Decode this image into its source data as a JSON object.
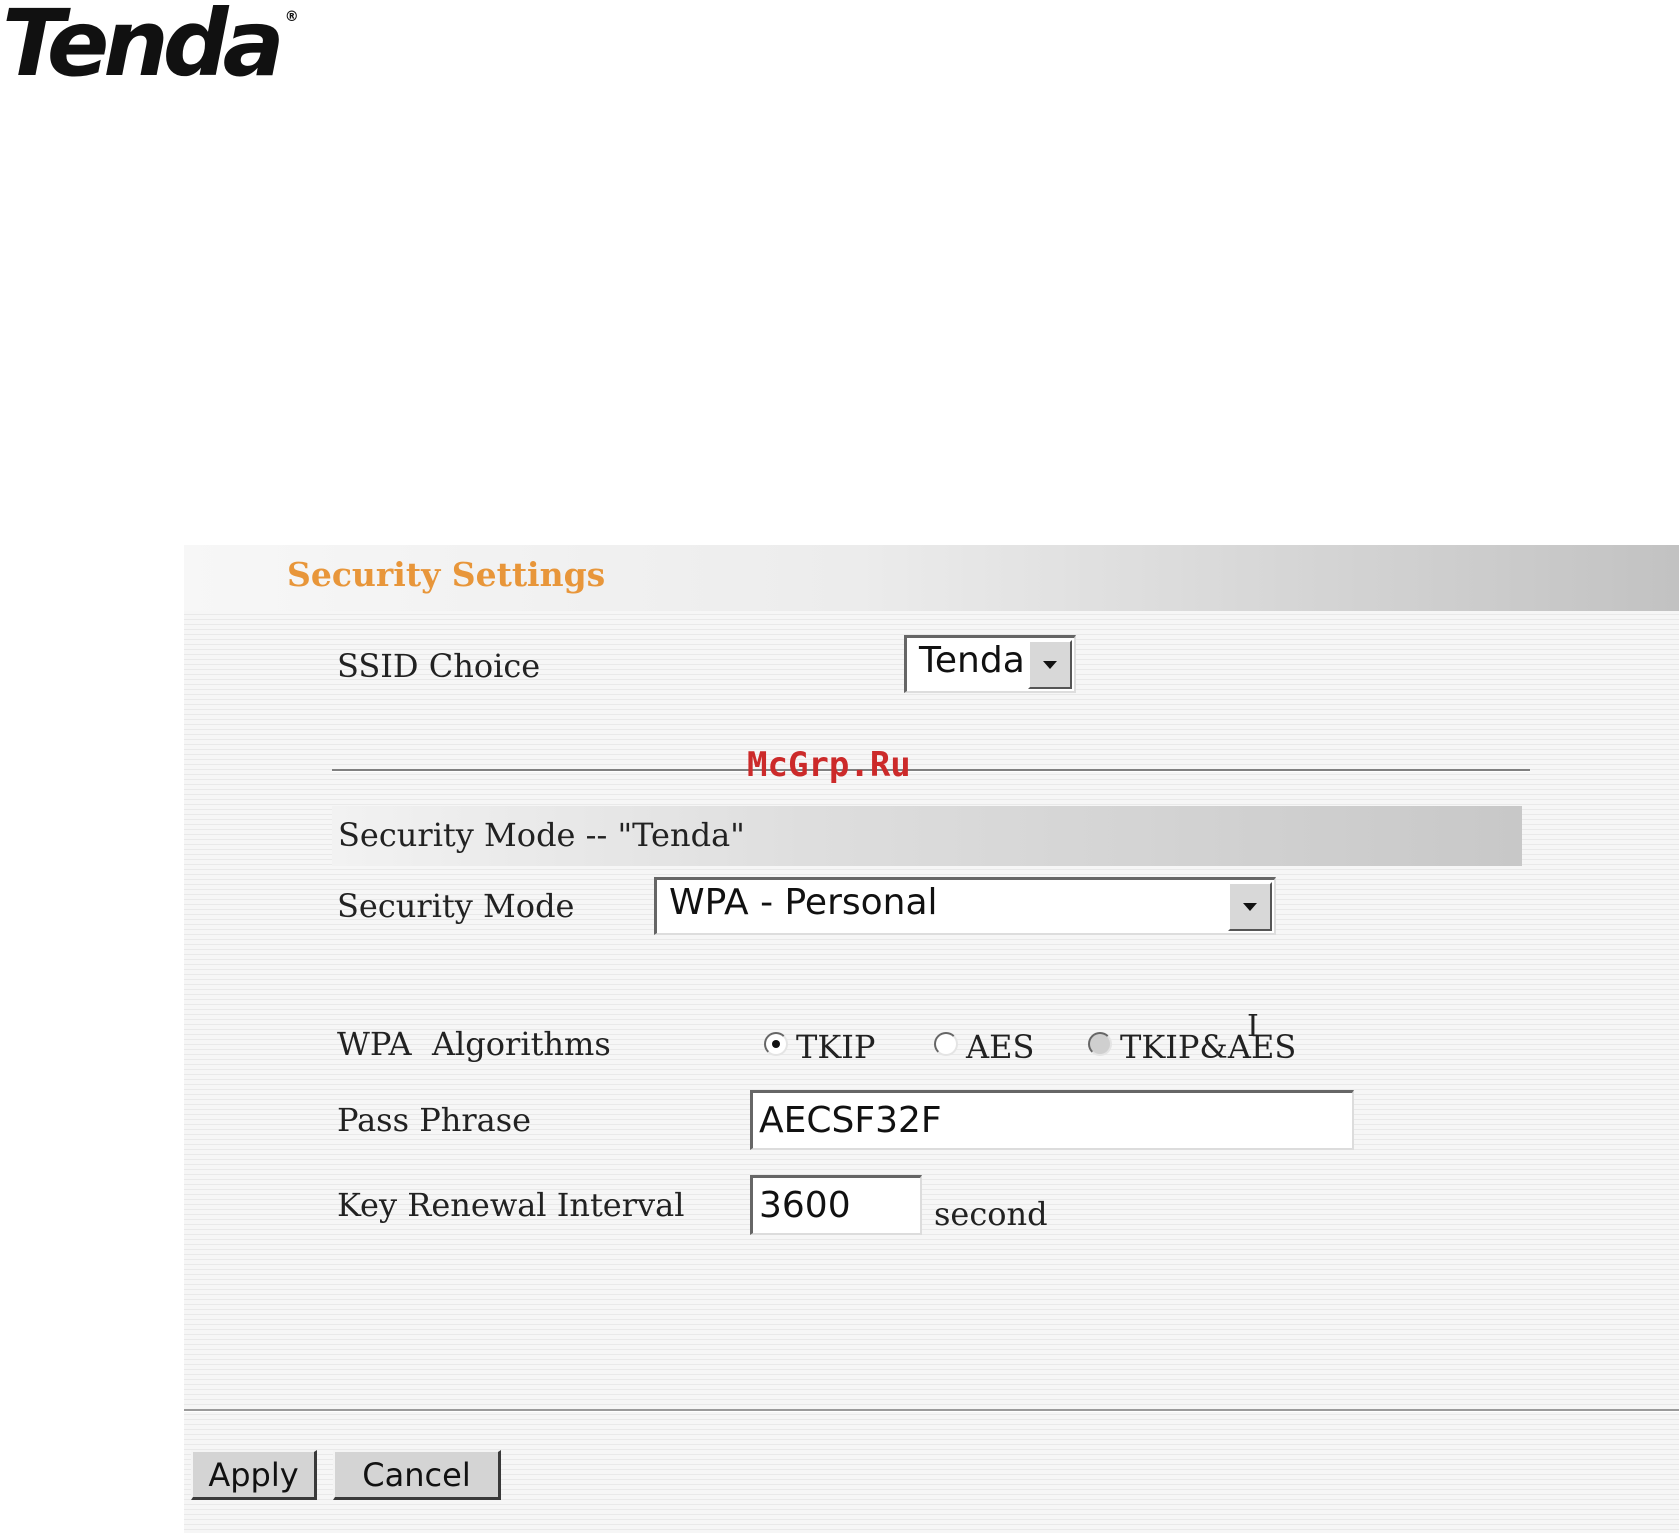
{
  "brand": {
    "logo_text": "Tenda",
    "registered_mark": "®"
  },
  "watermark": "McGrp.Ru",
  "panel": {
    "title": "Security Settings",
    "ssid_choice": {
      "label": "SSID Choice",
      "selected": "Tenda"
    },
    "section_title": "Security Mode -- \"Tenda\"",
    "security_mode": {
      "label": "Security Mode",
      "selected": "WPA - Personal"
    },
    "wpa_algorithms": {
      "label": "WPA  Algorithms",
      "options": [
        {
          "label": "TKIP",
          "checked": true,
          "disabled": false
        },
        {
          "label": "AES",
          "checked": false,
          "disabled": false
        },
        {
          "label": "TKIP&AES",
          "checked": false,
          "disabled": true
        }
      ]
    },
    "pass_phrase": {
      "label": "Pass Phrase",
      "value": "AECSF32F"
    },
    "key_renewal": {
      "label": "Key Renewal Interval",
      "value": "3600",
      "unit": "second"
    }
  },
  "buttons": {
    "apply": "Apply",
    "cancel": "Cancel"
  },
  "colors": {
    "title": "#e8963a",
    "watermark": "#cc2a2a"
  }
}
